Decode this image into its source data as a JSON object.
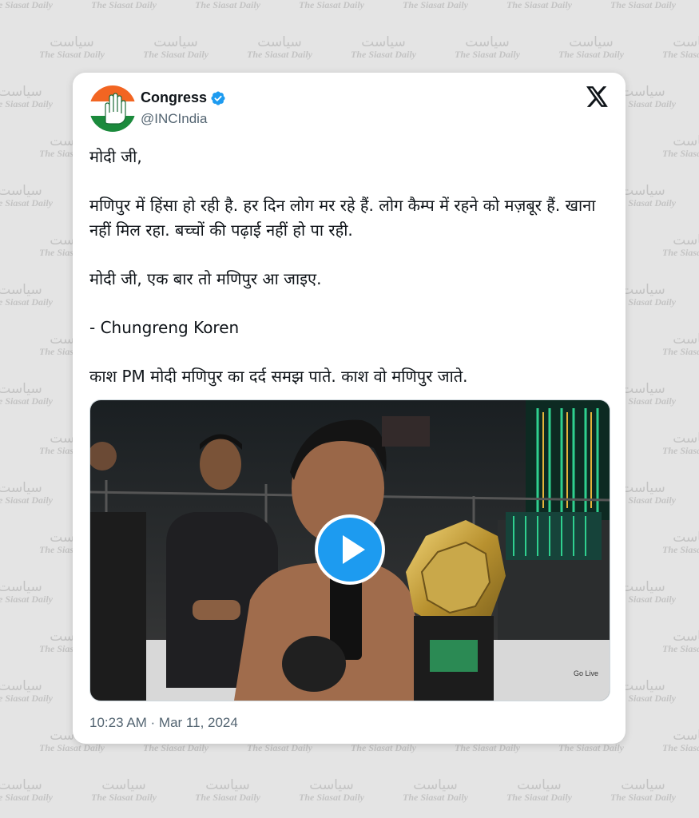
{
  "watermark": {
    "urdu": "سیاست",
    "english": "The Siasat Daily"
  },
  "tweet": {
    "author_name": "Congress",
    "author_handle": "@INCIndia",
    "paragraphs": [
      "मोदी जी,",
      "मणिपुर में हिंसा हो रही है. हर दिन लोग मर रहे हैं. लोग कैम्प में रहने को मज़बूर हैं. खाना नहीं मिल रहा. बच्चों की पढ़ाई नहीं हो पा रही.",
      "मोदी जी, एक बार तो मणिपुर आ जाइए.",
      "- Chungreng Koren",
      "काश PM मोदी मणिपुर का दर्द समझ पाते. काश वो मणिपुर जाते."
    ],
    "timestamp": "10:23 AM · Mar 11, 2024",
    "video_overlay": "Go Live"
  },
  "colors": {
    "accent": "#1d9bf0",
    "text": "#0f1419",
    "muted": "#536471",
    "saffron": "#f26522",
    "green": "#1b8a3c"
  },
  "icons": {
    "verified": "verified-badge-icon",
    "platform": "x-logo-icon",
    "play": "play-icon"
  }
}
